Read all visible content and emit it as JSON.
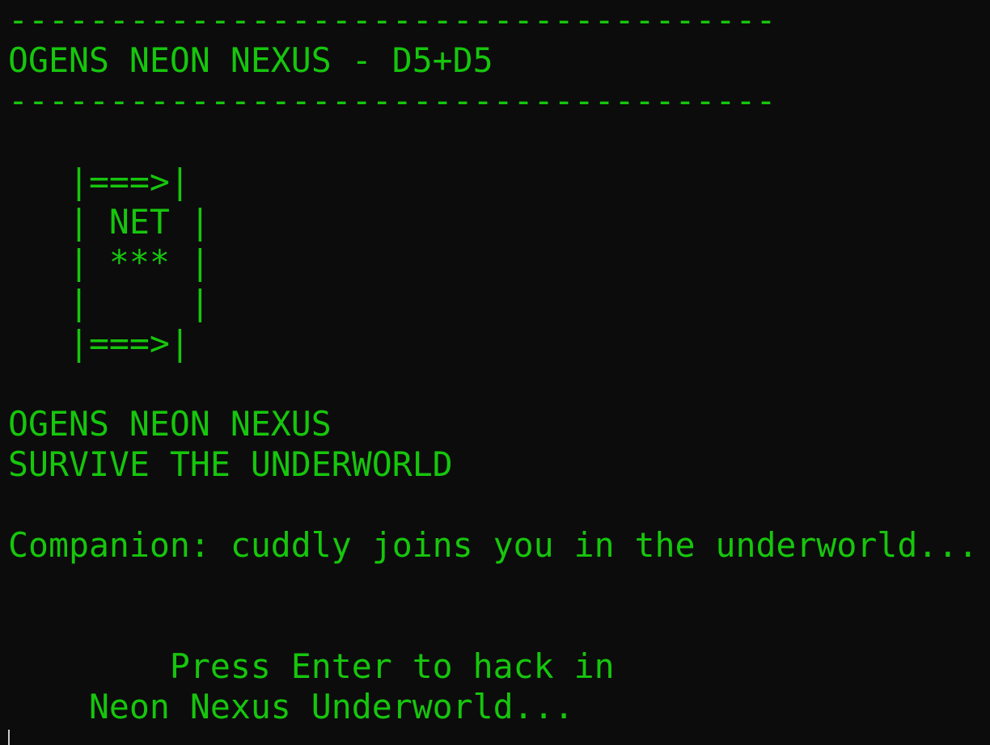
{
  "terminal": {
    "separator_top": "--------------------------------------",
    "title": "OGENS NEON NEXUS - D5+D5",
    "separator_bottom": "--------------------------------------",
    "art": [
      "   |===>|",
      "   | NET |",
      "   | *** |",
      "   |     |",
      "   |===>|"
    ],
    "heading": "OGENS NEON NEXUS",
    "subheading": "SURVIVE THE UNDERWORLD",
    "companion": "Companion: cuddly joins you in the underworld...",
    "prompt_line1": "        Press Enter to hack in",
    "prompt_line2": "    Neon Nexus Underworld..."
  },
  "colors": {
    "background": "#0c0c0c",
    "text": "#16c60c",
    "cursor": "#cccccc"
  }
}
